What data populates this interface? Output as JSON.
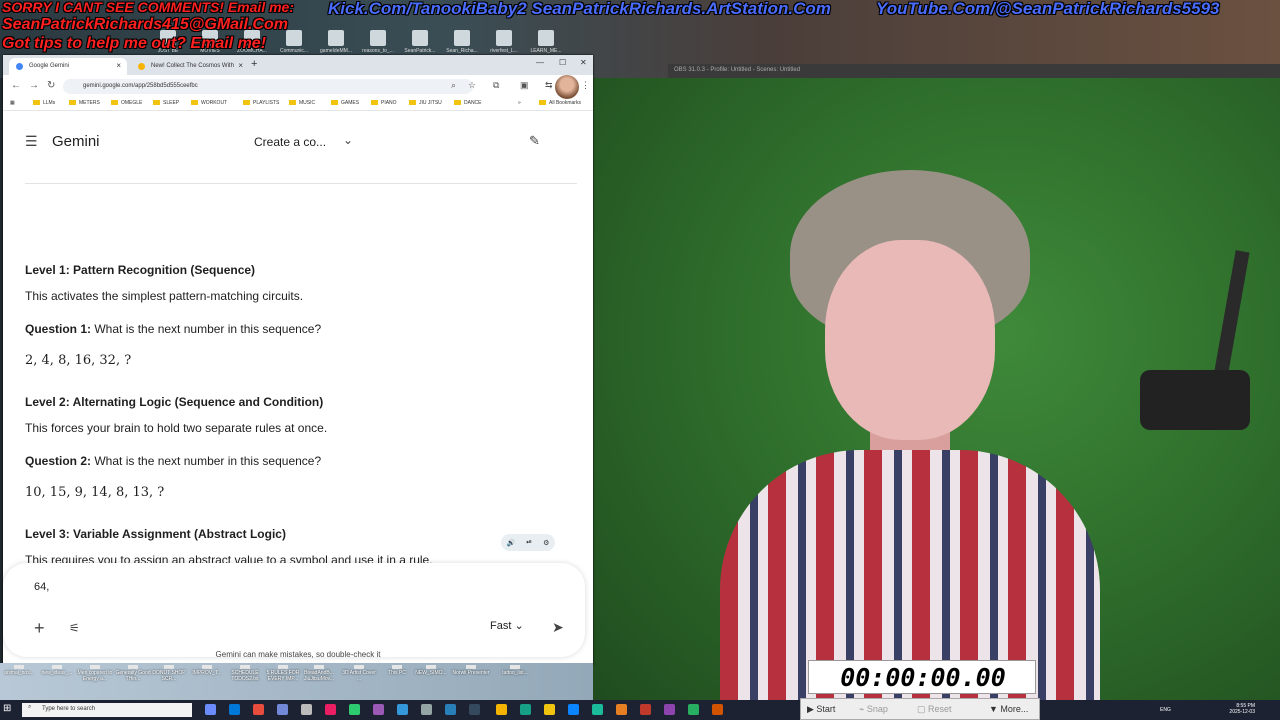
{
  "overlays": {
    "sorry": "SORRY I CANT SEE COMMENTS! Email me:",
    "email": "SeanPatrickRichards415@GMail.Com",
    "tips": "Got tips to help me out? Email me!",
    "kick": "Kick.Com/TanookiBaby2 SeanPatrickRichards.ArtStation.Com",
    "youtube": "YouTube.Com/@SeanPatrickRichards5593"
  },
  "desktop_top_icons": [
    "JUST BE",
    "MOVIES",
    "ZOOMCHA...",
    "Communic...",
    "gameIdeMM...",
    "reasons_to_...",
    "SeanPatrick...",
    "Sean_Richa...",
    "riverfest_L...",
    "LEARN_ME..."
  ],
  "obs": {
    "title": "OBS 31.0.3 - Profile: Untitled - Scenes: Untitled"
  },
  "browser": {
    "tabs": [
      {
        "label": "Google Gemini",
        "favicon_color": "#4285f4"
      },
      {
        "label": "New! Collect The Cosmos With",
        "favicon_color": "#f4b400"
      }
    ],
    "url": "gemini.google.com/app/258bd5d555ceefbc",
    "bookmarks": [
      "LLMs",
      "METERS",
      "OMEGLE",
      "SLEEP",
      "WORKOUT",
      "PLAYLISTS",
      "MUSIC",
      "GAMES",
      "PIANO",
      "JIU JITSU",
      "DANCE"
    ],
    "bookmarks_more": "»",
    "all_bookmarks": "All Bookmarks"
  },
  "gemini": {
    "title": "Gemini",
    "create_label": "Create a co...",
    "blocks": [
      {
        "kind": "h",
        "text": "Level 1: Pattern Recognition (Sequence)"
      },
      {
        "kind": "p",
        "text": "This activates the simplest pattern-matching circuits."
      },
      {
        "kind": "q",
        "label": "Question 1:",
        "text": " What is the next number in this sequence?"
      },
      {
        "kind": "math",
        "text": "2, 4, 8, 16, 32,  ?"
      },
      {
        "kind": "h",
        "text": "Level 2: Alternating Logic (Sequence and Condition)"
      },
      {
        "kind": "p",
        "text": "This forces your brain to hold two separate rules at once."
      },
      {
        "kind": "q",
        "label": "Question 2:",
        "text": " What is the next number in this sequence?"
      },
      {
        "kind": "math",
        "text": "10, 15, 9, 14, 8, 13,  ?"
      },
      {
        "kind": "h",
        "text": "Level 3: Variable Assignment (Abstract Logic)"
      },
      {
        "kind": "p",
        "text": "This requires you to assign an abstract value to a symbol and use it in a rule."
      },
      {
        "kind": "q",
        "label": "Question 3:",
        "text": ""
      }
    ],
    "prompt_value": "64, ",
    "mode": "Fast",
    "disclaimer": "Gemini can make mistakes, so double-check it"
  },
  "desktop_bottom_icons": [
    "animal_nos...",
    "new_ideas_...",
    "Men copared to Energy a...",
    "Generally Good THin...",
    "DONUT SHOP SCR...",
    "IMPROV_T...",
    "SCHEDULE TODOS2.txt",
    "5 RULES FOR EVERY IMP...",
    "BreadAndB... JiuJitsuMov...",
    "3D Artist Cover ...",
    "This PC",
    "NEW_SIMO...",
    "Norwii Presenter",
    "tattoo_list..."
  ],
  "timer": "00:00:00.00",
  "stopwatch": {
    "start": "Start",
    "snap": "Snap",
    "reset": "Reset",
    "more": "More..."
  },
  "taskbar": {
    "search_placeholder": "Type here to search",
    "time": "8:55 PM",
    "date": "2025-12-03",
    "lang": "ENG"
  }
}
